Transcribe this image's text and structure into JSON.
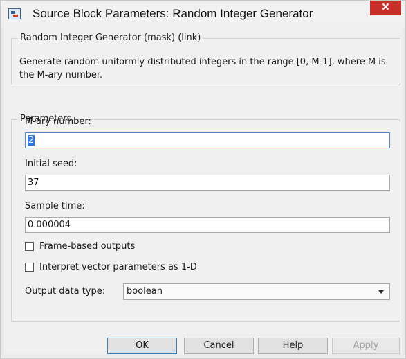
{
  "window": {
    "title": "Source Block Parameters: Random Integer Generator",
    "close_glyph": "✕"
  },
  "description_group": {
    "legend": "Random Integer Generator (mask) (link)",
    "text": "Generate random uniformly distributed integers in the range [0, M-1], where M is the M-ary number."
  },
  "parameters": {
    "legend": "Parameters",
    "mary_label": "M-ary number:",
    "mary_value": "2",
    "seed_label": "Initial seed:",
    "seed_value": "37",
    "sample_label": "Sample time:",
    "sample_value": "0.000004",
    "frame_label": "Frame-based outputs",
    "frame_checked": false,
    "interpret_label": "Interpret vector parameters as 1-D",
    "interpret_checked": false,
    "output_type_label": "Output data type:",
    "output_type_value": "boolean"
  },
  "buttons": {
    "ok": "OK",
    "cancel": "Cancel",
    "help": "Help",
    "apply": "Apply"
  },
  "colors": {
    "close_button": "#c9302c",
    "selection": "#3377d6",
    "focus_border": "#4f86d1"
  }
}
